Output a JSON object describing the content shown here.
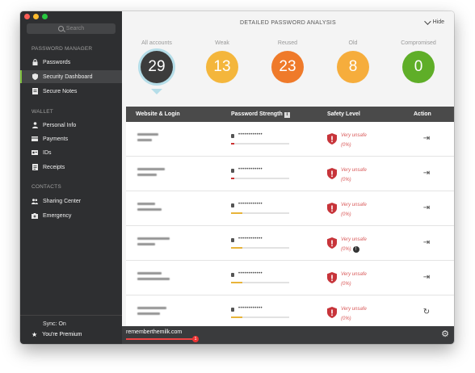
{
  "sidebar": {
    "search_placeholder": "Search",
    "sections": [
      {
        "label": "PASSWORD MANAGER"
      },
      {
        "label": "WALLET"
      },
      {
        "label": "CONTACTS"
      }
    ],
    "items": [
      {
        "label": "Passwords",
        "icon": "lock-icon"
      },
      {
        "label": "Security Dashboard",
        "icon": "shield-icon",
        "active": true
      },
      {
        "label": "Secure Notes",
        "icon": "note-icon"
      },
      {
        "label": "Personal Info",
        "icon": "person-icon"
      },
      {
        "label": "Payments",
        "icon": "card-icon"
      },
      {
        "label": "IDs",
        "icon": "id-icon"
      },
      {
        "label": "Receipts",
        "icon": "receipt-icon"
      },
      {
        "label": "Sharing Center",
        "icon": "people-icon"
      },
      {
        "label": "Emergency",
        "icon": "emergency-icon"
      }
    ],
    "sync": "Sync: On",
    "premium": "You're Premium"
  },
  "header": {
    "title": "DETAILED PASSWORD ANALYSIS",
    "hide_label": "Hide"
  },
  "stats": [
    {
      "label": "All accounts",
      "value": "29",
      "color": "#3c3c3c"
    },
    {
      "label": "Weak",
      "value": "13",
      "color": "#f4b63c"
    },
    {
      "label": "Reused",
      "value": "23",
      "color": "#ef7a2a"
    },
    {
      "label": "Old",
      "value": "8",
      "color": "#f6ad3c"
    },
    {
      "label": "Compromised",
      "value": "0",
      "color": "#5fae28"
    }
  ],
  "table": {
    "headers": {
      "site": "Website & Login",
      "strength": "Password Strength",
      "safety": "Safety Level",
      "action": "Action"
    },
    "rows": [
      {
        "dots": "••••••••••••",
        "strength": 0.05,
        "strength_color": "#cc3333",
        "safety": "Very unsafe",
        "pct": "(0%)",
        "action_icon": "login-icon",
        "warn": false
      },
      {
        "dots": "••••••••••••",
        "strength": 0.05,
        "strength_color": "#cc3333",
        "safety": "Very unsafe",
        "pct": "(0%)",
        "action_icon": "login-icon",
        "warn": false
      },
      {
        "dots": "••••••••••••",
        "strength": 0.2,
        "strength_color": "#e8b43a",
        "safety": "Very unsafe",
        "pct": "(0%)",
        "action_icon": "login-icon",
        "warn": false
      },
      {
        "dots": "••••••••••••",
        "strength": 0.2,
        "strength_color": "#e8b43a",
        "safety": "Very unsafe",
        "pct": "(0%)",
        "action_icon": "login-icon",
        "warn": true
      },
      {
        "dots": "••••••••••••",
        "strength": 0.2,
        "strength_color": "#e8b43a",
        "safety": "Very unsafe",
        "pct": "(0%)",
        "action_icon": "login-icon",
        "warn": false
      },
      {
        "dots": "••••••••••••",
        "strength": 0.2,
        "strength_color": "#e8b43a",
        "safety": "Very unsafe",
        "pct": "(0%)",
        "action_icon": "refresh-icon",
        "warn": false
      }
    ]
  },
  "bottom_bar": {
    "text": "rememberthemilk.com",
    "badge": "1"
  },
  "colors": {
    "sidebar_bg": "#2e2f31",
    "accent_green": "#7fbf3f",
    "unsafe_red": "#d95a5a"
  }
}
